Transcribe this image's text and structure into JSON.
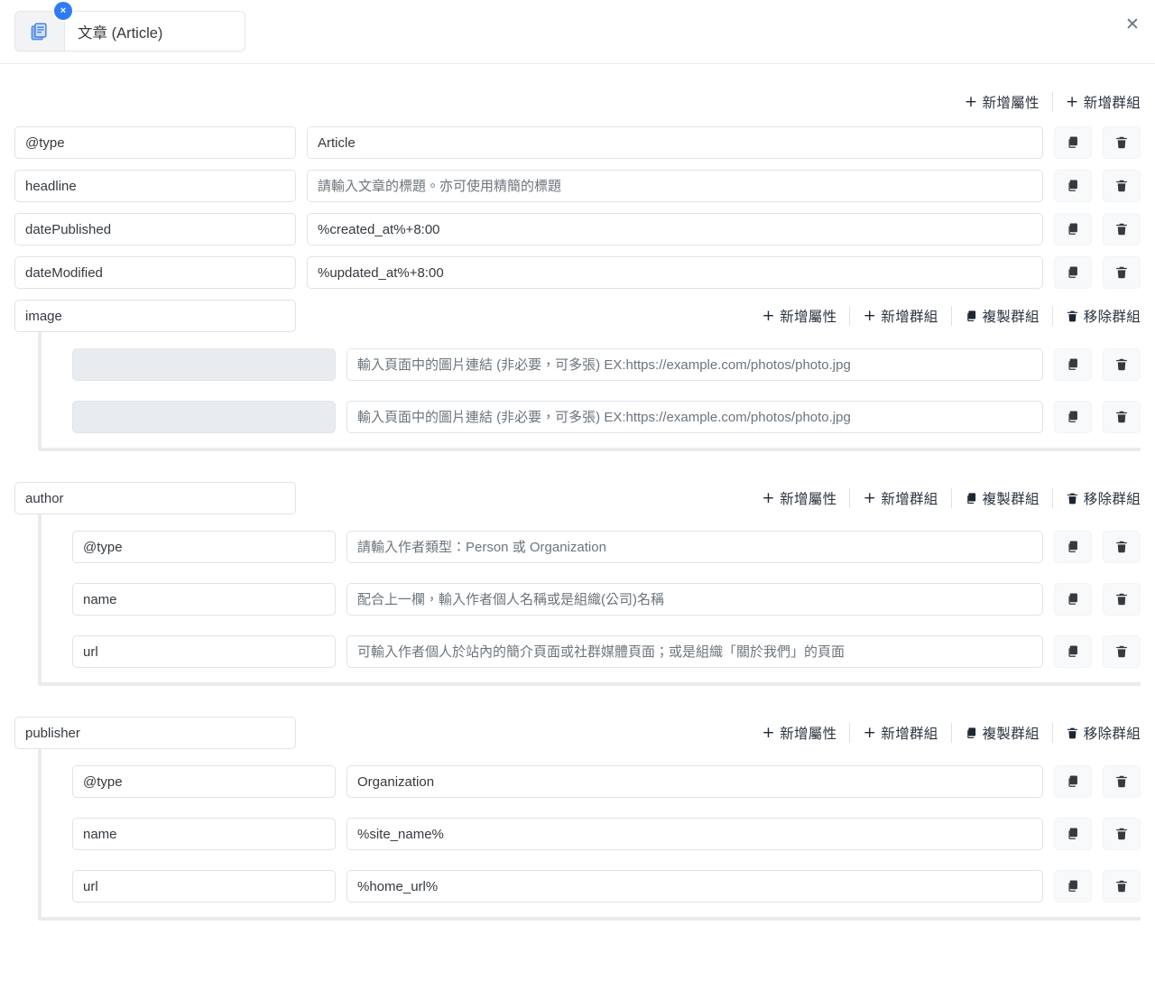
{
  "header": {
    "type_label": "文章 (Article)",
    "doc_icon": "article-icon",
    "badge_label": "×",
    "close_label": "✕"
  },
  "toolbar": {
    "add_property": "新增屬性",
    "add_group": "新增群組",
    "duplicate_group": "複製群組",
    "remove_group": "移除群組",
    "plus": "+",
    "copy_icon": "copy-icon",
    "trash_icon": "trash-icon"
  },
  "row_actions": {
    "copy": "copy-icon",
    "delete": "trash-icon"
  },
  "properties": [
    {
      "key": "@type",
      "value": "Article",
      "key_placeholder": "",
      "value_placeholder": "",
      "disabled_key": false
    },
    {
      "key": "headline",
      "value": "",
      "key_placeholder": "",
      "value_placeholder": "請輸入文章的標題。亦可使用精簡的標題",
      "disabled_key": false
    },
    {
      "key": "datePublished",
      "value": "%created_at%+8:00",
      "key_placeholder": "",
      "value_placeholder": "",
      "disabled_key": false
    },
    {
      "key": "dateModified",
      "value": "%updated_at%+8:00",
      "key_placeholder": "",
      "value_placeholder": "",
      "disabled_key": false
    }
  ],
  "groups": [
    {
      "key": "image",
      "children": [
        {
          "key": "",
          "value": "",
          "key_placeholder": "",
          "value_placeholder": "輸入頁面中的圖片連結 (非必要，可多張) EX:https://example.com/photos/photo.jpg",
          "disabled_key": true
        },
        {
          "key": "",
          "value": "",
          "key_placeholder": "",
          "value_placeholder": "輸入頁面中的圖片連結 (非必要，可多張) EX:https://example.com/photos/photo.jpg",
          "disabled_key": true
        }
      ]
    },
    {
      "key": "author",
      "children": [
        {
          "key": "@type",
          "value": "",
          "key_placeholder": "",
          "value_placeholder": "請輸入作者類型：Person 或 Organization",
          "disabled_key": false
        },
        {
          "key": "name",
          "value": "",
          "key_placeholder": "",
          "value_placeholder": "配合上一欄，輸入作者個人名稱或是組織(公司)名稱",
          "disabled_key": false
        },
        {
          "key": "url",
          "value": "",
          "key_placeholder": "",
          "value_placeholder": "可輸入作者個人於站內的簡介頁面或社群媒體頁面；或是組織「關於我們」的頁面",
          "disabled_key": false
        }
      ]
    },
    {
      "key": "publisher",
      "children": [
        {
          "key": "@type",
          "value": "Organization",
          "key_placeholder": "",
          "value_placeholder": "",
          "disabled_key": false
        },
        {
          "key": "name",
          "value": "%site_name%",
          "key_placeholder": "",
          "value_placeholder": "",
          "disabled_key": false
        },
        {
          "key": "url",
          "value": "%home_url%",
          "key_placeholder": "",
          "value_placeholder": "",
          "disabled_key": false
        }
      ]
    }
  ],
  "colors": {
    "accent": "#2f7bf6",
    "border": "#dfe3e8",
    "group_rail": "#e9ecef",
    "text": "#343a40",
    "muted": "#6c757d"
  }
}
